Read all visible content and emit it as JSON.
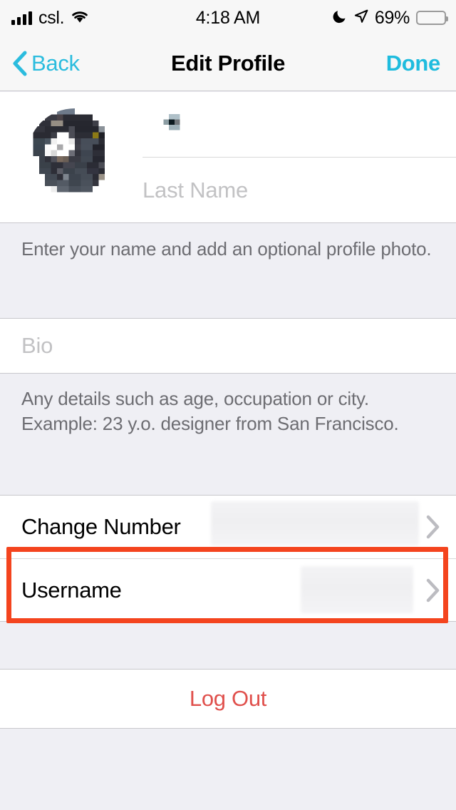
{
  "status_bar": {
    "carrier": "csl.",
    "time": "4:18 AM",
    "battery_percent": "69%",
    "battery_color": "#FCCC0A",
    "icons": [
      "signal-bars-icon",
      "wifi-icon",
      "do-not-disturb-moon-icon",
      "location-arrow-icon",
      "battery-icon"
    ]
  },
  "nav_bar": {
    "back_label": "Back",
    "title": "Edit Profile",
    "done_label": "Done",
    "tint_color": "#2BBCDE"
  },
  "profile": {
    "avatar_alt": "profile-photo-redacted",
    "first_name_value": "",
    "last_name_placeholder": "Last Name",
    "footer_note": "Enter your name and add an optional profile photo."
  },
  "bio": {
    "placeholder": "Bio",
    "footer_note": "Any details such as age, occupation or city. Example: 23 y.o. designer from San Francisco."
  },
  "settings_rows": [
    {
      "label": "Change Number",
      "value": "",
      "value_redacted": true,
      "accessory": "chevron-right-icon"
    },
    {
      "label": "Username",
      "value": "",
      "value_redacted": true,
      "accessory": "chevron-right-icon"
    }
  ],
  "logout": {
    "label": "Log Out",
    "color": "#E0504C"
  },
  "annotation": {
    "target": "Username",
    "color": "#F4441E"
  },
  "theme": {
    "background": "#EFEFF4",
    "row_background": "#FFFFFF",
    "separator": "#C8C7CC",
    "placeholder_text": "#C2C2C4",
    "footer_text": "#6D6D72"
  }
}
